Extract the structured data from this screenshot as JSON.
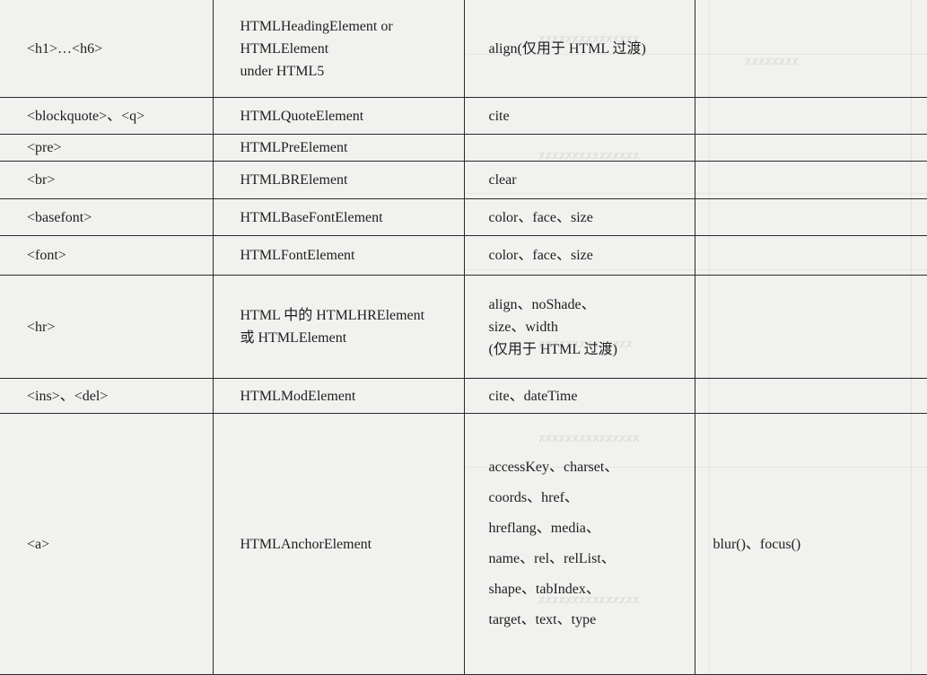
{
  "table": {
    "rows": [
      {
        "col1": [
          "<h1>…<h6>"
        ],
        "col2": [
          "HTMLHeadingElement or",
          "HTMLElement",
          "under HTML5"
        ],
        "col3": [
          "align(仅用于 HTML 过渡)"
        ],
        "col4": []
      },
      {
        "col1": [
          "<blockquote>、<q>"
        ],
        "col2": [
          "HTMLQuoteElement"
        ],
        "col3": [
          "cite"
        ],
        "col4": []
      },
      {
        "col1": [
          "<pre>"
        ],
        "col2": [
          "HTMLPreElement"
        ],
        "col3": [],
        "col4": []
      },
      {
        "col1": [
          "<br>"
        ],
        "col2": [
          "HTMLBRElement"
        ],
        "col3": [
          "clear"
        ],
        "col4": []
      },
      {
        "col1": [
          "<basefont>"
        ],
        "col2": [
          "HTMLBaseFontElement"
        ],
        "col3": [
          "color、face、size"
        ],
        "col4": []
      },
      {
        "col1": [
          "<font>"
        ],
        "col2": [
          "HTMLFontElement"
        ],
        "col3": [
          "color、face、size"
        ],
        "col4": []
      },
      {
        "col1": [
          "<hr>"
        ],
        "col2": [
          "HTML 中的 HTMLHRElement",
          "或 HTMLElement"
        ],
        "col3": [
          "align、noShade、",
          "size、width",
          "(仅用于 HTML 过渡)"
        ],
        "col4": []
      },
      {
        "col1": [
          "<ins>、<del>"
        ],
        "col2": [
          "HTMLModElement"
        ],
        "col3": [
          "cite、dateTime"
        ],
        "col4": []
      },
      {
        "col1": [
          "<a>"
        ],
        "col2": [
          "HTMLAnchorElement"
        ],
        "col3": [
          "accessKey、charset、",
          "coords、href、",
          "hreflang、media、",
          "name、rel、relList、",
          "shape、tabIndex、",
          "target、text、type"
        ],
        "col4": [
          "blur()、focus()"
        ]
      }
    ]
  }
}
